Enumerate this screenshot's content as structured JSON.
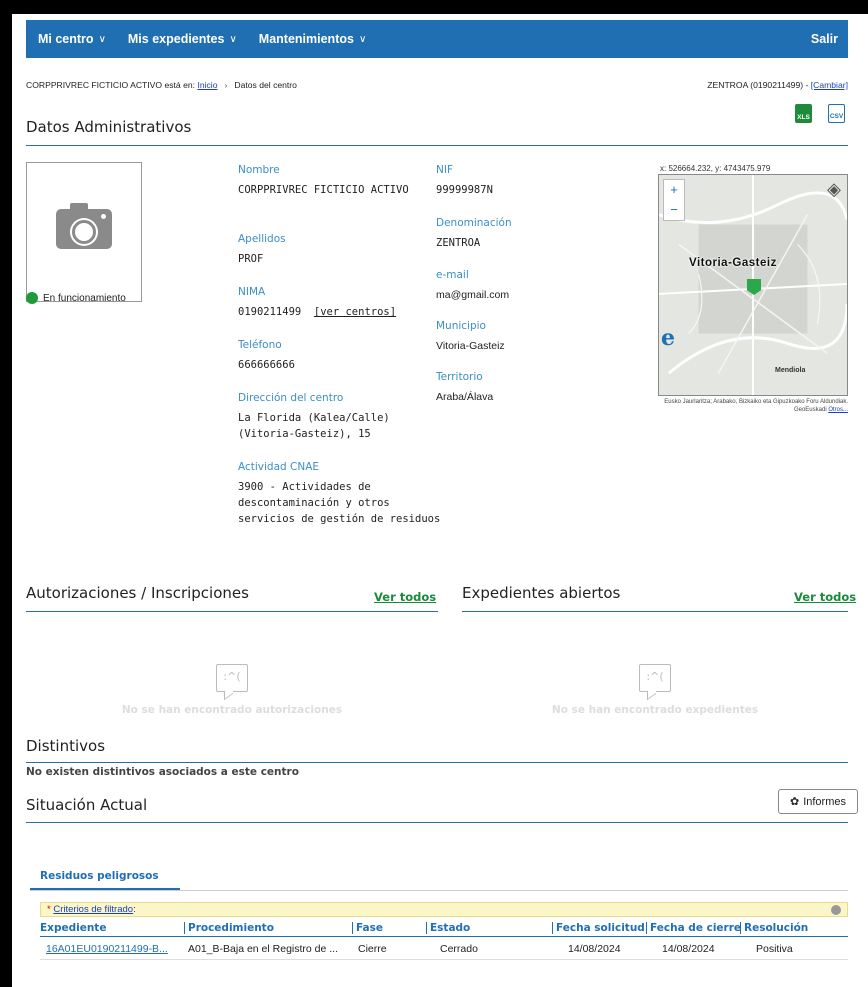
{
  "nav": {
    "menus": [
      {
        "label": "Mi centro"
      },
      {
        "label": "Mis expedientes"
      },
      {
        "label": "Mantenimientos"
      }
    ],
    "logout": "Salir"
  },
  "breadcrumb": {
    "prefix": "CORPPRIVREC FICTICIO ACTIVO está en:",
    "home": "Inicio",
    "separator": "›",
    "current": "Datos del centro",
    "centre": "ZENTROA (0190211499) -",
    "change": "[Cambiar]"
  },
  "admin": {
    "title": "Datos Administrativos",
    "export_xls": "XLS",
    "export_csv": "CSV",
    "status": "En funcionamiento",
    "status_color": "#1e9a3a",
    "fields_left": {
      "nombre_label": "Nombre",
      "nombre_value": "CORPPRIVREC FICTICIO ACTIVO",
      "apellidos_label": "Apellidos",
      "apellidos_value": "PROF",
      "nima_label": "NIMA",
      "nima_value": "0190211499",
      "nima_link": "[ver centros]",
      "telefono_label": "Teléfono",
      "telefono_value": "666666666",
      "direccion_label": "Dirección del centro",
      "direccion_value": "La Florida (Kalea/Calle) (Vitoria-Gasteiz), 15",
      "cnae_label": "Actividad CNAE",
      "cnae_value": "3900 - Actividades de descontaminación y otros servicios de gestión de residuos"
    },
    "fields_right": {
      "nif_label": "NIF",
      "nif_value": "99999987N",
      "denominacion_label": "Denominación",
      "denominacion_value": "ZENTROA",
      "email_label": "e-mail",
      "email_value": "ma@gmail.com",
      "municipio_label": "Municipio",
      "municipio_value": "Vitoria-Gasteiz",
      "territorio_label": "Territorio",
      "territorio_value": "Araba/Álava"
    },
    "map": {
      "coords": "x: 526664.232, y: 4743475.979",
      "city_label": "Vitoria-Gasteiz",
      "area_label": "Mendiola",
      "zoom_in": "+",
      "zoom_out": "−",
      "attribution": "Eusko Jaurlaritza; Arabako, Bizkaiko eta Gipuzkoako Foru Aldundiak. GeoEuskadi",
      "attribution_link": "Otros..."
    }
  },
  "autorizaciones": {
    "title": "Autorizaciones / Inscripciones",
    "ver_todos": "Ver todos",
    "empty": "No se han encontrado autorizaciones"
  },
  "expedientes": {
    "title": "Expedientes abiertos",
    "ver_todos": "Ver todos",
    "empty": "No se han encontrado expedientes"
  },
  "distintivos": {
    "title": "Distintivos",
    "empty": "No existen distintivos asociados a este centro"
  },
  "situacion": {
    "title": "Situación Actual",
    "informes": "Informes",
    "tab": "Residuos peligrosos",
    "filter_star": "*",
    "filter_link": "Criterios de filtrado",
    "filter_colon": ":",
    "columns": [
      "Expediente",
      "Procedimiento",
      "Fase",
      "Estado",
      "Fecha solicitud",
      "Fecha de cierre",
      "Resolución"
    ],
    "rows": [
      [
        "16A01EU0190211499-B...",
        "A01_B-Baja en el Registro de ...",
        "Cierre",
        "Cerrado",
        "14/08/2024",
        "14/08/2024",
        "Positiva"
      ]
    ]
  },
  "colors": {
    "nav_bg": "#1f6fb2",
    "link_green": "#1a8a3a",
    "label_blue": "#3a8fc4"
  }
}
